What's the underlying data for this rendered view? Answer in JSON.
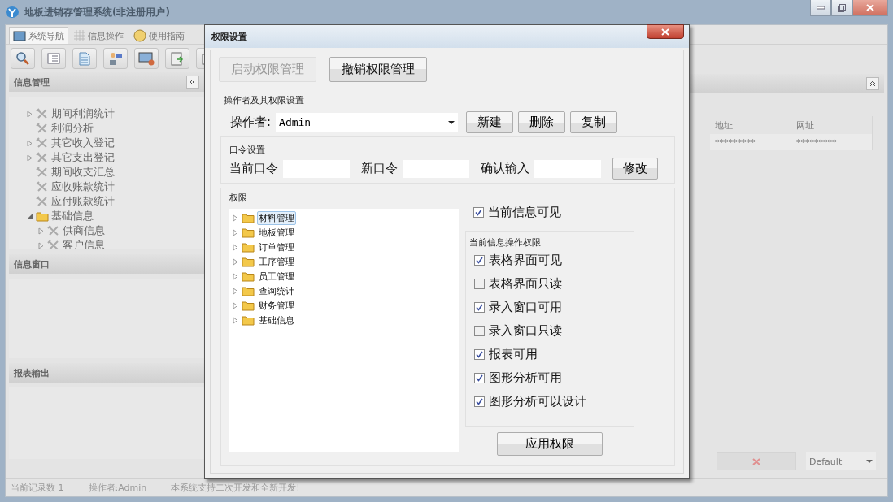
{
  "window": {
    "title": "地板进销存管理系统(非注册用户)"
  },
  "tabs": [
    {
      "label": "系统导航",
      "selected": true
    },
    {
      "label": "信息操作",
      "selected": false
    },
    {
      "label": "使用指南",
      "selected": false
    }
  ],
  "sidebar": {
    "title": "信息管理",
    "tree": [
      {
        "label": "期间利润统计",
        "has_children": true
      },
      {
        "label": "利润分析",
        "has_children": false
      },
      {
        "label": "其它收入登记",
        "has_children": true
      },
      {
        "label": "其它支出登记",
        "has_children": true
      },
      {
        "label": "期间收支汇总",
        "has_children": false
      },
      {
        "label": "应收账款统计",
        "has_children": false
      },
      {
        "label": "应付账款统计",
        "has_children": false
      },
      {
        "label": "基础信息",
        "has_children": true,
        "expanded": true,
        "children": [
          {
            "label": "供商信息",
            "has_children": true
          },
          {
            "label": "客户信息",
            "has_children": true
          }
        ]
      }
    ],
    "panels": [
      {
        "title": "信息窗口"
      },
      {
        "title": "报表输出"
      }
    ]
  },
  "table": {
    "columns": [
      "地址",
      "网址"
    ],
    "rows": [
      [
        "*********",
        "*********"
      ]
    ]
  },
  "footer": {
    "dropdown": "Default"
  },
  "status_bar": [
    "当前记录数 1",
    "操作者:Admin",
    "本系统支持二次开发和全新开发!"
  ],
  "dialog": {
    "title": "权限设置",
    "top_buttons": [
      {
        "label": "启动权限管理",
        "disabled": true
      },
      {
        "label": "撤销权限管理",
        "disabled": false
      }
    ],
    "operator_section": {
      "title": "操作者及其权限设置",
      "label": "操作者:",
      "value": "Admin",
      "buttons": [
        "新建",
        "删除",
        "复制"
      ]
    },
    "password_section": {
      "title": "口令设置",
      "fields": [
        {
          "label": "当前口令"
        },
        {
          "label": "新口令"
        },
        {
          "label": "确认输入"
        }
      ],
      "button": "修改"
    },
    "permissions": {
      "title": "权限",
      "tree": [
        {
          "label": "材料管理",
          "selected": true
        },
        {
          "label": "地板管理",
          "selected": false
        },
        {
          "label": "订单管理",
          "selected": false
        },
        {
          "label": "工序管理",
          "selected": false
        },
        {
          "label": "员工管理",
          "selected": false
        },
        {
          "label": "查询统计",
          "selected": false
        },
        {
          "label": "财务管理",
          "selected": false
        },
        {
          "label": "基础信息",
          "selected": false
        }
      ],
      "visible": {
        "label": "当前信息可见",
        "checked": true
      },
      "group_title": "当前信息操作权限",
      "options": [
        {
          "label": "表格界面可见",
          "checked": true
        },
        {
          "label": "表格界面只读",
          "checked": false
        },
        {
          "label": "录入窗口可用",
          "checked": true
        },
        {
          "label": "录入窗口只读",
          "checked": false
        },
        {
          "label": "报表可用",
          "checked": true
        },
        {
          "label": "图形分析可用",
          "checked": true
        },
        {
          "label": "图形分析可以设计",
          "checked": true
        }
      ],
      "apply_button": "应用权限"
    }
  }
}
